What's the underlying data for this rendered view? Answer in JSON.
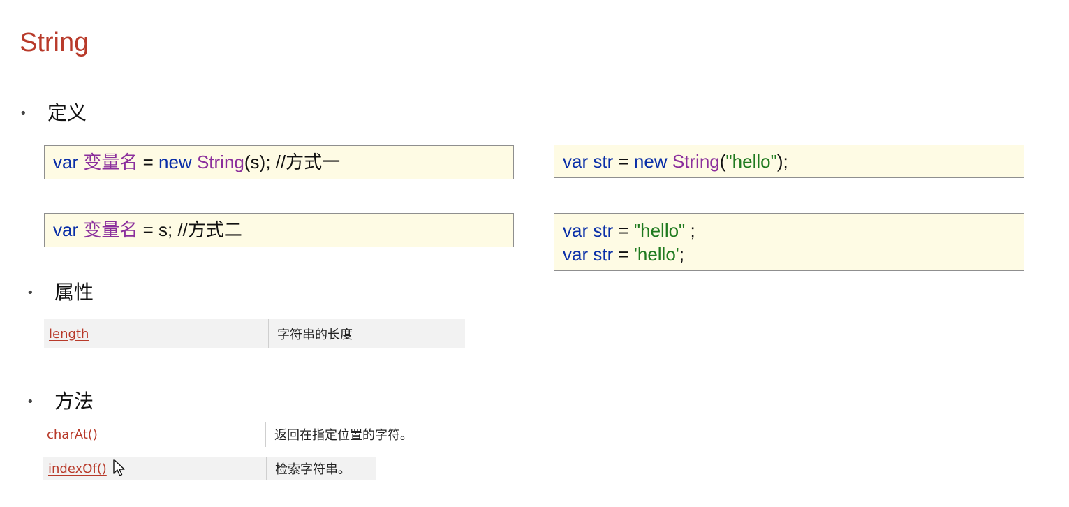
{
  "page": {
    "title": "String"
  },
  "sections": {
    "definition": {
      "heading": "定义",
      "syntax_one": {
        "kw": "var",
        "name": "变量名",
        "eq": " = ",
        "new_kw": "new",
        "cls": "String",
        "rest": "(s); //方式一"
      },
      "syntax_two": {
        "kw": "var",
        "name": "变量名",
        "rest": " = s; //方式二"
      },
      "example_one": {
        "kw": "var",
        "var": "str",
        "eq": " = ",
        "new_kw": "new",
        "cls": "String",
        "open": "(",
        "str": "\"hello\"",
        "close": ");"
      },
      "example_two": {
        "line1_kw": "var",
        "line1_var": "str",
        "line1_eq": " = ",
        "line1_str": "\"hello\"",
        "line1_end": " ;",
        "line2_kw": "var",
        "line2_var": "str",
        "line2_eq": " = ",
        "line2_str": "'hello'",
        "line2_end": ";"
      }
    },
    "properties": {
      "heading": "属性",
      "rows": [
        {
          "name": "length",
          "desc": "字符串的长度"
        }
      ]
    },
    "methods": {
      "heading": "方法",
      "rows": [
        {
          "name": "charAt()",
          "desc": "返回在指定位置的字符。"
        },
        {
          "name": "indexOf()",
          "desc": "检索字符串。"
        }
      ]
    }
  },
  "bullet_glyph": "•",
  "colors": {
    "title": "#b83a2a",
    "keyword": "#0a2fa8",
    "class": "#8b2f9c",
    "string": "#1f7a1f",
    "code_bg": "#fefbe4",
    "link": "#b83a2a"
  },
  "icons": {
    "cursor": "arrow-pointer-icon"
  }
}
